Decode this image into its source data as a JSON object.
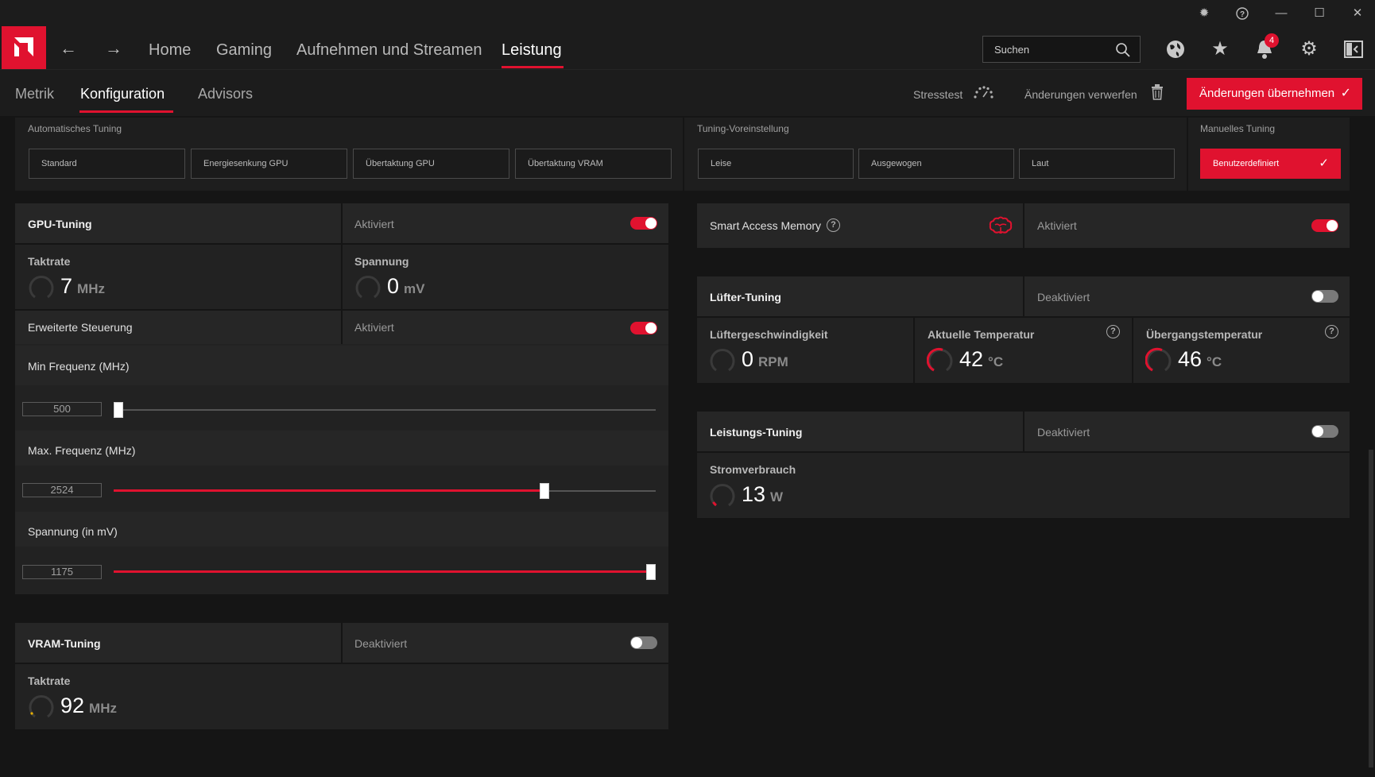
{
  "window": {
    "buttons": [
      "bug-report",
      "help",
      "minimize",
      "maximize",
      "close"
    ]
  },
  "nav": {
    "tabs": [
      "Home",
      "Gaming",
      "Aufnehmen und Streamen",
      "Leistung"
    ],
    "active_tab": "Leistung",
    "search_placeholder": "Suchen",
    "notification_count": "4"
  },
  "subnav": {
    "tabs": [
      "Metrik",
      "Konfiguration",
      "Advisors"
    ],
    "active_tab": "Konfiguration",
    "stress_test": "Stresstest",
    "discard": "Änderungen verwerfen",
    "apply": "Änderungen übernehmen"
  },
  "presets": {
    "auto_label": "Automatisches Tuning",
    "auto_buttons": [
      "Standard",
      "Energiesenkung GPU",
      "Übertaktung GPU",
      "Übertaktung VRAM"
    ],
    "preset_label": "Tuning-Voreinstellung",
    "preset_buttons": [
      "Leise",
      "Ausgewogen",
      "Laut"
    ],
    "manual_label": "Manuelles Tuning",
    "manual_button": "Benutzerdefiniert"
  },
  "gpu_tuning": {
    "title": "GPU-Tuning",
    "status": "Aktiviert",
    "enabled": true,
    "clock_label": "Taktrate",
    "clock_value": "7",
    "clock_unit": "MHz",
    "voltage_label": "Spannung",
    "voltage_value": "0",
    "voltage_unit": "mV",
    "advanced_label": "Erweiterte Steuerung",
    "advanced_status": "Aktiviert",
    "advanced_enabled": true,
    "min_freq_label": "Min Frequenz (MHz)",
    "min_freq_value": "500",
    "min_freq_fraction": 0.0,
    "max_freq_label": "Max. Frequenz (MHz)",
    "max_freq_value": "2524",
    "max_freq_fraction": 0.8,
    "voltage_slider_label": "Spannung (in mV)",
    "voltage_slider_value": "1175",
    "voltage_slider_fraction": 1.0
  },
  "vram_tuning": {
    "title": "VRAM-Tuning",
    "status": "Deaktiviert",
    "enabled": false,
    "clock_label": "Taktrate",
    "clock_value": "92",
    "clock_unit": "MHz"
  },
  "sam": {
    "title": "Smart Access Memory",
    "status": "Aktiviert",
    "enabled": true
  },
  "fan_tuning": {
    "title": "Lüfter-Tuning",
    "status": "Deaktiviert",
    "enabled": false,
    "fan_speed_label": "Lüftergeschwindigkeit",
    "fan_speed_value": "0",
    "fan_speed_unit": "RPM",
    "temp_label": "Aktuelle Temperatur",
    "temp_value": "42",
    "temp_unit": "°C",
    "junction_label": "Übergangstemperatur",
    "junction_value": "46",
    "junction_unit": "°C"
  },
  "power_tuning": {
    "title": "Leistungs-Tuning",
    "status": "Deaktiviert",
    "enabled": false,
    "power_label": "Stromverbrauch",
    "power_value": "13",
    "power_unit": "W"
  },
  "colors": {
    "accent": "#e0122f",
    "background": "#151515",
    "card": "#222222"
  }
}
